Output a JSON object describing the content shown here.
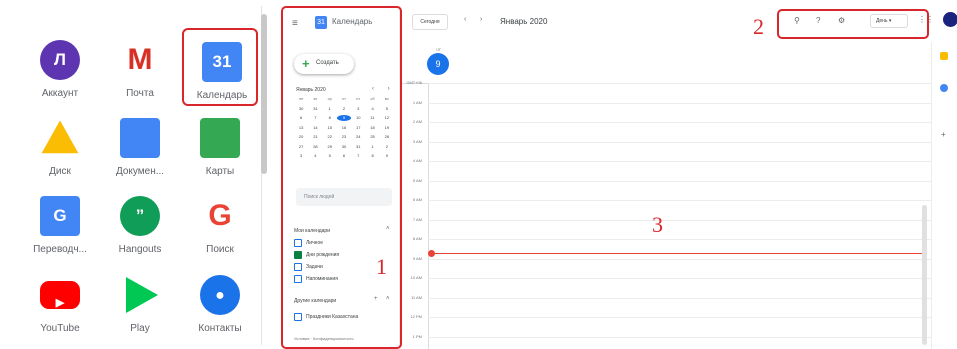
{
  "launcher": {
    "apps": [
      {
        "label": "Аккаунт",
        "icon": "account-icon",
        "letter": "Л",
        "color": "#5e35b1"
      },
      {
        "label": "Почта",
        "icon": "gmail-icon",
        "letter": "M",
        "color": "#d93025"
      },
      {
        "label": "Календарь",
        "icon": "calendar-icon",
        "letter": "31",
        "color": "#4285f4"
      },
      {
        "label": "Диск",
        "icon": "drive-icon",
        "color": "#fbbc04"
      },
      {
        "label": "Докумен...",
        "icon": "docs-icon",
        "color": "#4285f4"
      },
      {
        "label": "Карты",
        "icon": "maps-icon",
        "color": "#34a853"
      },
      {
        "label": "Переводч...",
        "icon": "translate-icon",
        "letter": "G",
        "color": "#4285f4"
      },
      {
        "label": "Hangouts",
        "icon": "hangouts-icon",
        "letter": "”",
        "color": "#0f9d58"
      },
      {
        "label": "Поиск",
        "icon": "google-search-icon",
        "letter": "G",
        "color": "#ea4335"
      },
      {
        "label": "YouTube",
        "icon": "youtube-icon",
        "color": "#ff0000"
      },
      {
        "label": "Play",
        "icon": "play-store-icon",
        "color": "#00c853"
      },
      {
        "label": "Контакты",
        "icon": "contacts-icon",
        "color": "#1a73e8"
      }
    ]
  },
  "calendar": {
    "app_title": "Календарь",
    "logo_text": "31",
    "menu_glyph": "≡",
    "create_label": "Создать",
    "create_glyph": "+",
    "mini_month": "Январь 2020",
    "mini_nav": "‹ ›",
    "weekdays": [
      "пн",
      "вт",
      "ср",
      "чт",
      "пт",
      "сб",
      "вс"
    ],
    "days": [
      "30",
      "31",
      "1",
      "2",
      "3",
      "4",
      "5",
      "6",
      "7",
      "8",
      "9",
      "10",
      "11",
      "12",
      "13",
      "14",
      "15",
      "16",
      "17",
      "18",
      "19",
      "20",
      "21",
      "22",
      "23",
      "24",
      "25",
      "26",
      "27",
      "28",
      "29",
      "30",
      "31",
      "1",
      "2",
      "3",
      "4",
      "5",
      "6",
      "7",
      "8",
      "9"
    ],
    "today_index": 10,
    "search_people_placeholder": "Поиск людей",
    "my_calendars_title": "Мои календари",
    "my_calendars": [
      {
        "name": "Личное",
        "checked": false
      },
      {
        "name": "Дни рождения",
        "checked": true
      },
      {
        "name": "Задачи",
        "checked": false
      },
      {
        "name": "Напоминания",
        "checked": false
      }
    ],
    "other_calendars_title": "Другие календари",
    "other_calendars": [
      {
        "name": "Праздники Казахстана",
        "checked": false
      }
    ],
    "section_arrow": "˄",
    "add_glyph": "+",
    "footer": "Условия · Конфиденциальность"
  },
  "topbar": {
    "today_label": "Сегодня",
    "prev_glyph": "‹",
    "next_glyph": "›",
    "month_title": "Январь 2020",
    "search_glyph": "⚲",
    "help_glyph": "?",
    "settings_glyph": "⚙",
    "view_label": "День ▾",
    "apps_glyph": "⋮⋮"
  },
  "day_view": {
    "day_label": "ЧТ",
    "day_number": "9",
    "hours": [
      "GMT+06",
      "1 AM",
      "2 AM",
      "3 AM",
      "4 AM",
      "5 AM",
      "6 AM",
      "7 AM",
      "8 AM",
      "9 AM",
      "10 AM",
      "11 AM",
      "12 PM",
      "1 PM"
    ]
  },
  "annotations": {
    "side_pane": "1",
    "top_controls": "2",
    "day_grid": "3"
  },
  "colors": {
    "highlight": "#d9262b",
    "primary": "#1a73e8",
    "now_line": "#ea4335"
  }
}
